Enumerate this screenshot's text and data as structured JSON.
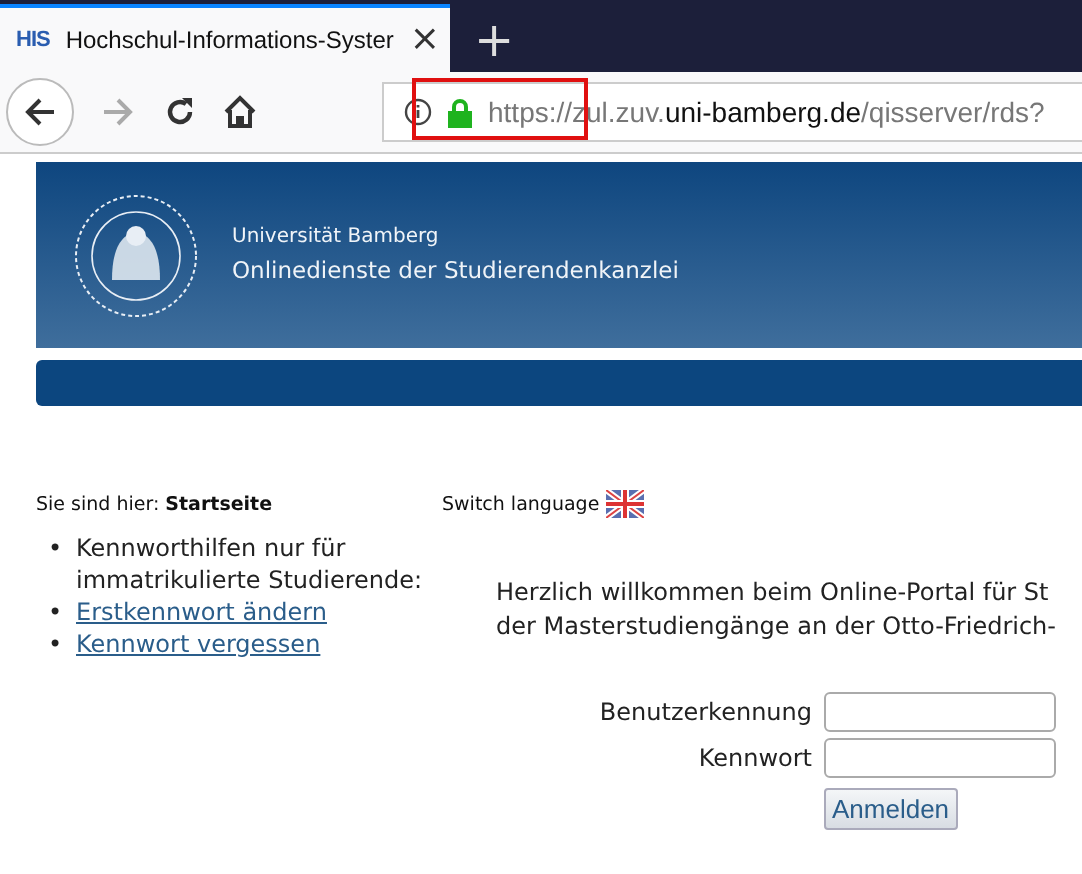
{
  "browser": {
    "tab": {
      "favicon": "HIS",
      "title": "Hochschul-Informations-Syster",
      "close": "×",
      "selected": true
    },
    "new_tab": "+",
    "url": {
      "prefix": "https://zul.zuv.",
      "domain": "uni-bamberg.de",
      "path": "/qisserver/rds?"
    },
    "secure": true
  },
  "header": {
    "university": "Universität Bamberg",
    "subtitle": "Onlinedienste der Studierendenkanzlei"
  },
  "breadcrumb": {
    "label": "Sie sind hier:",
    "current": "Startseite"
  },
  "language": {
    "label": "Switch language"
  },
  "sidebar": {
    "items": [
      {
        "kind": "text",
        "marker": "•",
        "text": "Kennworthilfen nur für immatrikulierte Studierende:"
      },
      {
        "kind": "link",
        "marker": "•",
        "text": "Erstkennwort ändern"
      },
      {
        "kind": "link",
        "marker": "•",
        "text": "Kennwort vergessen"
      }
    ]
  },
  "welcome": [
    "Herzlich willkommen beim Online-Portal für St",
    "der Masterstudiengänge an der Otto-Friedrich-"
  ],
  "login": {
    "fields": [
      {
        "label": "Benutzerkennung"
      },
      {
        "label": "Kennwort"
      }
    ],
    "button": "Anmelden"
  }
}
